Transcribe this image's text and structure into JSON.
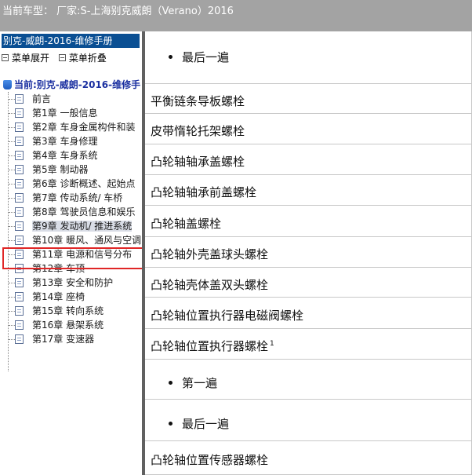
{
  "header": {
    "title": "当前车型：  厂家:S-上海别克威朗（Verano）2016"
  },
  "sidebar": {
    "manual_title": "别克-威朗-2016-维修手册",
    "expand_label": "菜单展开",
    "collapse_label": "菜单折叠",
    "root_label": "当前:别克-威朗-2016-维修手",
    "items": [
      "前言",
      "第1章 一般信息",
      "第2章 车身金属构件和装",
      "第3章 车身修理",
      "第4章 车身系统",
      "第5章 制动器",
      "第6章 诊断概述、起始点",
      "第7章 传动系统/ 车桥",
      "第8章 驾驶员信息和娱乐",
      "第9章 发动机/ 推进系统",
      "第10章 暖风、通风与空调",
      "第11章 电源和信号分布",
      "第12章 车顶",
      "第13章 安全和防护",
      "第14章 座椅",
      "第15章 转向系统",
      "第16章 悬架系统",
      "第17章 变速器"
    ],
    "selected_index": 9
  },
  "content": {
    "rows": [
      {
        "text": "最后一遍",
        "bullet": true
      },
      {
        "text": "平衡链条导板螺栓",
        "bullet": false
      },
      {
        "text": "皮带惰轮托架螺栓",
        "bullet": false
      },
      {
        "text": "凸轮轴轴承盖螺栓",
        "bullet": false
      },
      {
        "text": "凸轮轴轴承前盖螺栓",
        "bullet": false
      },
      {
        "text": "凸轮轴盖螺栓",
        "bullet": false
      },
      {
        "text": "凸轮轴外壳盖球头螺栓",
        "bullet": false
      },
      {
        "text": "凸轮轴壳体盖双头螺栓",
        "bullet": false
      },
      {
        "text": "凸轮轴位置执行器电磁阀螺栓",
        "bullet": false
      },
      {
        "text": "凸轮轴位置执行器螺栓",
        "bullet": false,
        "sup": "1"
      },
      {
        "text": "第一遍",
        "bullet": true
      },
      {
        "text": "最后一遍",
        "bullet": true
      },
      {
        "text": "凸轮轴位置传感器螺栓",
        "bullet": false
      }
    ]
  }
}
